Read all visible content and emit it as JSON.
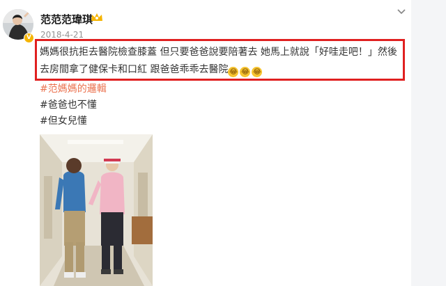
{
  "post": {
    "username": "范范范瑋琪",
    "timestamp": "2018-4-21",
    "text": "媽媽很抗拒去醫院檢查膝蓋 但只要爸爸說要陪著去 她馬上就說「好哇走吧！」然後去房間拿了健保卡和口紅 跟爸爸乖乖去醫院",
    "emojis": [
      "😂",
      "😂",
      "😂"
    ],
    "hashtags": [
      "#范媽媽的邏輯",
      "#爸爸也不懂",
      "#但女兒懂"
    ]
  },
  "icons": {
    "avatar": "user-avatar",
    "badge": "verified-badge-icon",
    "vip": "vip-crown-icon",
    "menu": "chevron-down-icon",
    "emoji": "laughing-emoji-icon"
  },
  "colors": {
    "highlight_border": "#e02020",
    "hashtag_link": "#eb7350",
    "timestamp": "#939393",
    "badge": "#f5b400"
  }
}
